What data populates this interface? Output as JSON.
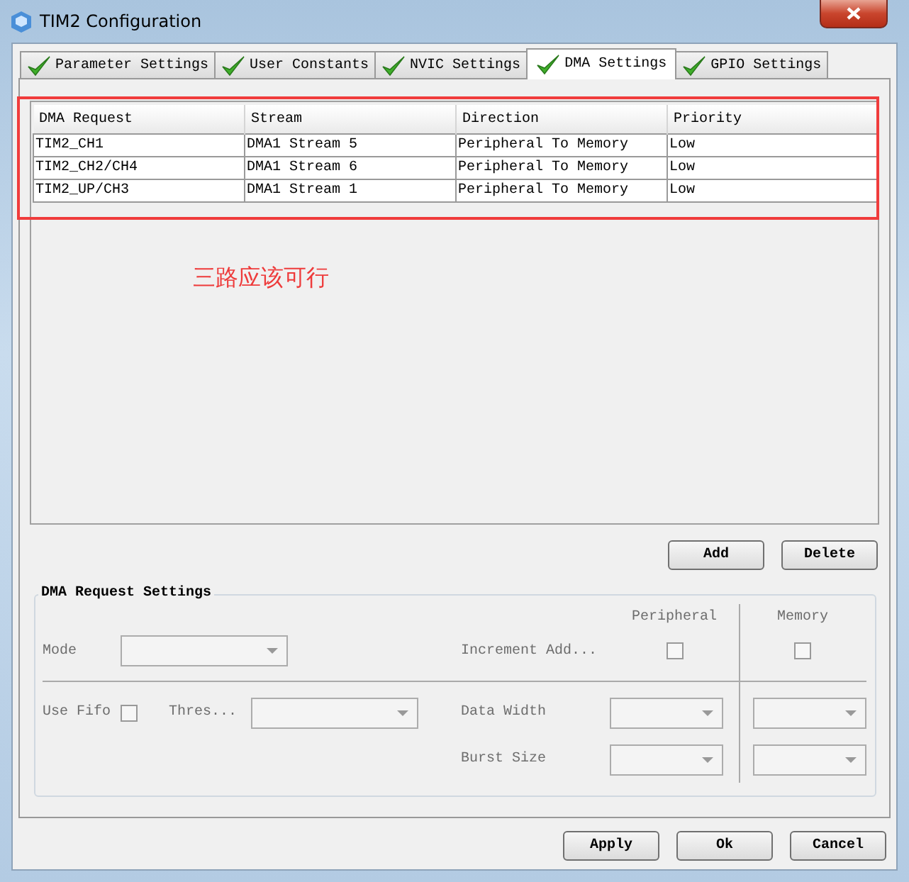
{
  "window": {
    "title": "TIM2 Configuration"
  },
  "tabs": [
    {
      "label": "Parameter Settings",
      "selected": false
    },
    {
      "label": "User Constants",
      "selected": false
    },
    {
      "label": "NVIC Settings",
      "selected": false
    },
    {
      "label": "DMA Settings",
      "selected": true
    },
    {
      "label": "GPIO Settings",
      "selected": false
    }
  ],
  "table": {
    "columns": [
      "DMA Request",
      "Stream",
      "Direction",
      "Priority"
    ],
    "rows": [
      [
        "TIM2_CH1",
        "DMA1 Stream 5",
        "Peripheral To Memory",
        "Low"
      ],
      [
        "TIM2_CH2/CH4",
        "DMA1 Stream 6",
        "Peripheral To Memory",
        "Low"
      ],
      [
        "TIM2_UP/CH3",
        "DMA1 Stream 1",
        "Peripheral To Memory",
        "Low"
      ]
    ]
  },
  "annotation": {
    "text": "三路应该可行"
  },
  "list_buttons": [
    "Add",
    "Delete"
  ],
  "dma_request_settings": {
    "title": "DMA Request Settings",
    "disabled": true,
    "mode_label": "Mode",
    "peripheral_label": "Peripheral",
    "memory_label": "Memory",
    "increment_label": "Increment Add...",
    "peripheral_increment_checked": false,
    "memory_increment_checked": false,
    "use_fifo_label": "Use Fifo",
    "use_fifo_checked": false,
    "threshold_label": "Thres...",
    "data_width_label": "Data Width",
    "burst_size_label": "Burst Size"
  },
  "buttons": [
    "Apply",
    "Ok",
    "Cancel"
  ]
}
